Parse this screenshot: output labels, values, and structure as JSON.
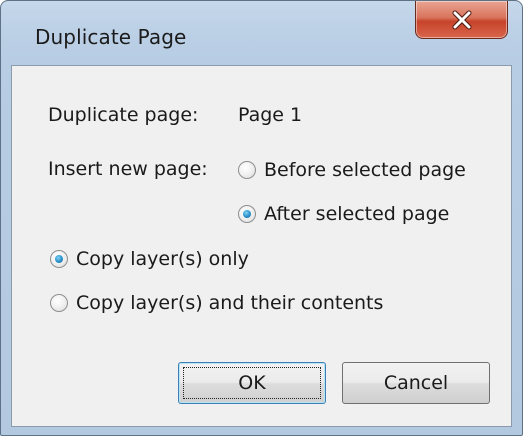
{
  "window": {
    "title": "Duplicate Page",
    "close_icon": "close-icon"
  },
  "fields": {
    "duplicate_page_label": "Duplicate page:",
    "duplicate_page_value": "Page 1",
    "insert_new_page_label": "Insert new page:"
  },
  "insert_position": {
    "options": [
      {
        "label": "Before selected page",
        "checked": false
      },
      {
        "label": "After selected page",
        "checked": true
      }
    ]
  },
  "copy_mode": {
    "options": [
      {
        "label": "Copy layer(s) only",
        "checked": true
      },
      {
        "label": "Copy layer(s) and their contents",
        "checked": false
      }
    ]
  },
  "buttons": {
    "ok_label": "OK",
    "cancel_label": "Cancel"
  },
  "colors": {
    "accent": "#2a8fc9",
    "close_red": "#c7432b",
    "frame_blue": "#b7cde3",
    "client_bg": "#f0f0f0"
  }
}
